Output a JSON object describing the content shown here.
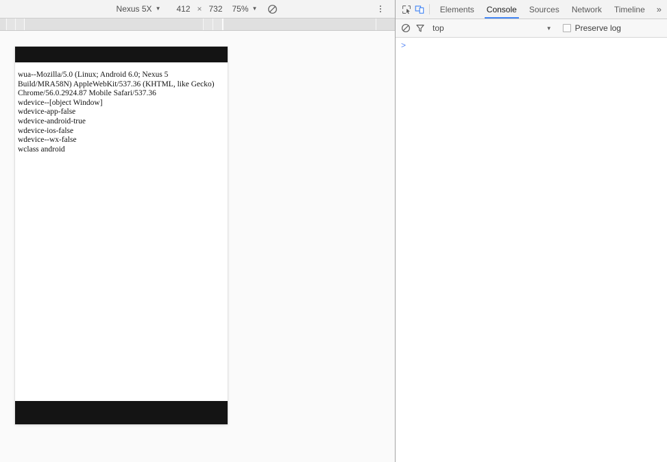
{
  "device_toolbar": {
    "device_name": "Nexus 5X",
    "device_caret": "▼",
    "width": "412",
    "separator": "×",
    "height": "732",
    "zoom": "75%",
    "zoom_caret": "▼",
    "rotate_icon": "rotate-icon",
    "overflow_icon": "more-vertical-icon"
  },
  "emulated_page": {
    "log_lines": [
      "wua--Mozilla/5.0 (Linux; Android 6.0; Nexus 5 Build/MRA58N) AppleWebKit/537.36 (KHTML, like Gecko) Chrome/56.0.2924.87 Mobile Safari/537.36",
      "wdevice--[object Window]",
      "wdevice-app-false",
      "wdevice-android-true",
      "wdevice-ios-false",
      "wdevice--wx-false",
      "wclass android"
    ]
  },
  "devtools": {
    "inspect_icon": "inspect-element-icon",
    "device_toggle_icon": "toggle-device-toolbar-icon",
    "tabs": [
      {
        "label": "Elements",
        "active": false
      },
      {
        "label": "Console",
        "active": true
      },
      {
        "label": "Sources",
        "active": false
      },
      {
        "label": "Network",
        "active": false
      },
      {
        "label": "Timeline",
        "active": false
      }
    ],
    "more_tabs": "»",
    "console": {
      "clear_icon": "clear-console-icon",
      "filter_icon": "filter-icon",
      "context": "top",
      "context_caret": "▼",
      "preserve_log_label": "Preserve log",
      "preserve_log_checked": false,
      "prompt": ">"
    }
  },
  "colors": {
    "accent": "#4285f4",
    "prompt": "#5b8af5",
    "page_bar": "#141414",
    "toolbar_bg": "#f3f3f3",
    "ruler_bg": "#e4e4e4"
  }
}
